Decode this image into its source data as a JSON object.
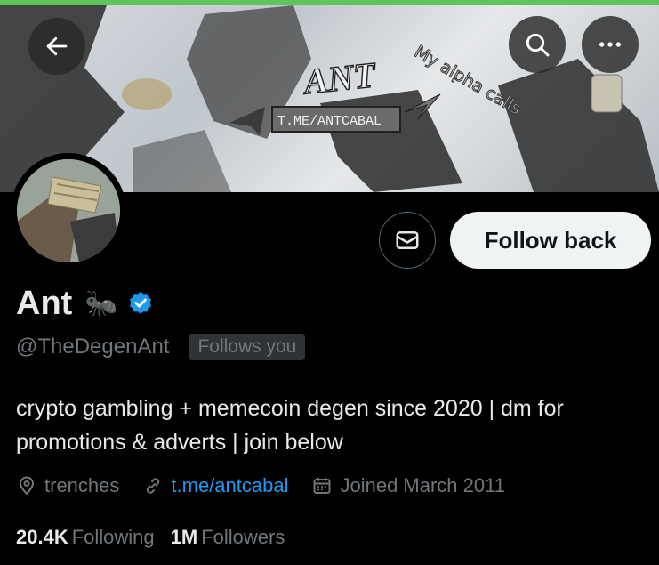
{
  "colors": {
    "accent": "#61c35b",
    "link": "#1d9bf0",
    "verified": "#1d9bf0",
    "muted": "#71767b",
    "text": "#e7e9ea",
    "follow_button_bg": "#eff3f4"
  },
  "banner": {
    "title_text": "ANT",
    "link_text": "T.ME/ANTCABAL",
    "tagline": "My alpha calls"
  },
  "header": {
    "back_icon": "arrow-left-icon",
    "search_icon": "search-icon",
    "more_icon": "more-horizontal-icon"
  },
  "profile": {
    "name": "Ant",
    "emoji": "🐜",
    "handle": "@TheDegenAnt",
    "follows_you": "Follows you",
    "bio": "crypto gambling + memecoin degen since 2020 | dm for promotions & adverts | join below",
    "location": "trenches",
    "website": "t.me/antcabal",
    "joined": "Joined March 2011"
  },
  "actions": {
    "message_icon": "envelope-icon",
    "follow_label": "Follow back"
  },
  "stats": {
    "following_count": "20.4K",
    "following_label": "Following",
    "followers_count": "1M",
    "followers_label": "Followers"
  }
}
